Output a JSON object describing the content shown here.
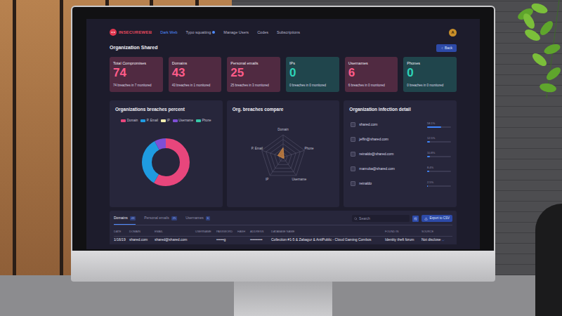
{
  "nav": {
    "logo": "INSECUREWEB",
    "tabs": [
      {
        "label": "Dark Web",
        "selected": true,
        "dot": false
      },
      {
        "label": "Typo squatting",
        "selected": false,
        "dot": true
      },
      {
        "label": "Manage Users",
        "selected": false,
        "dot": false
      },
      {
        "label": "Codes",
        "selected": false,
        "dot": false
      },
      {
        "label": "Subscriptions",
        "selected": false,
        "dot": false
      }
    ],
    "avatar": "A"
  },
  "page": {
    "title": "Organization Shared",
    "back_button": "Back"
  },
  "cards": [
    {
      "label": "Total Compromises",
      "value": "74",
      "detail": "74 breaches in 7 monitored",
      "color": "#ff5c8a"
    },
    {
      "label": "Domains",
      "value": "43",
      "detail": "43 breaches in 1 monitored",
      "color": "#ff5c8a"
    },
    {
      "label": "Personal emails",
      "value": "25",
      "detail": "25 breaches in 3 monitored",
      "color": "#ff5c8a"
    },
    {
      "label": "IPs",
      "value": "0",
      "detail": "0 breaches in 0 monitored",
      "color": "#2ed3b7"
    },
    {
      "label": "Usernames",
      "value": "6",
      "detail": "6 breaches in 0 monitored",
      "color": "#ff5c8a"
    },
    {
      "label": "Phones",
      "value": "0",
      "detail": "0 breaches in 0 monitored",
      "color": "#2ed3b7"
    }
  ],
  "breaches_percent": {
    "title": "Organizations breaches percent",
    "legend": [
      {
        "label": "Domain",
        "color": "#e8467c"
      },
      {
        "label": "P. Email",
        "color": "#1f9be0"
      },
      {
        "label": "IP",
        "color": "#f2eeb0"
      },
      {
        "label": "Username",
        "color": "#7e4fd6"
      },
      {
        "label": "Phone",
        "color": "#36c9a8"
      }
    ],
    "values": [
      43,
      25,
      0,
      6,
      0
    ]
  },
  "breaches_compare": {
    "title": "Org. breaches compare",
    "axes": [
      "Domain",
      "Phone",
      "Username",
      "IP",
      "P. Email"
    ],
    "values": [
      43,
      0,
      6,
      0,
      25
    ]
  },
  "infection_detail": {
    "title": "Organization infection detail",
    "items": [
      {
        "name": "shared.com",
        "reading": "58.1%",
        "level": 0.581
      },
      {
        "name": "jeffin@shared.com",
        "reading": "12.5%",
        "level": 0.125
      },
      {
        "name": "reinaldo@shared.com",
        "reading": "10.8%",
        "level": 0.108
      },
      {
        "name": "mamuba@shared.com",
        "reading": "8.4%",
        "level": 0.084
      },
      {
        "name": "reinaldo",
        "reading": "2.5%",
        "level": 0.025
      }
    ]
  },
  "table": {
    "tabs": [
      {
        "label": "Domains",
        "count": "43",
        "selected": true
      },
      {
        "label": "Personal emails",
        "count": "25",
        "selected": false
      },
      {
        "label": "Usernames",
        "count": "6",
        "selected": false
      }
    ],
    "search": {
      "placeholder": "Search"
    },
    "export_button": "Export to CSV",
    "columns": [
      "DATE",
      "DOMAIN",
      "EMAIL",
      "USERNAME",
      "PASSWORD",
      "HASH",
      "ADDRESS",
      "DATABASE NAME",
      "FOUND IN",
      "SOURCE"
    ],
    "rows": [
      [
        "1/16/19",
        "shared.com",
        "shared@shared.com",
        "",
        "••••••g",
        "",
        "••••••••••",
        "Collection #1-5 & Zabagur & AntiPublic - Cloud Gaming Combos",
        "Identity theft forum",
        "Not disclose"
      ]
    ]
  }
}
